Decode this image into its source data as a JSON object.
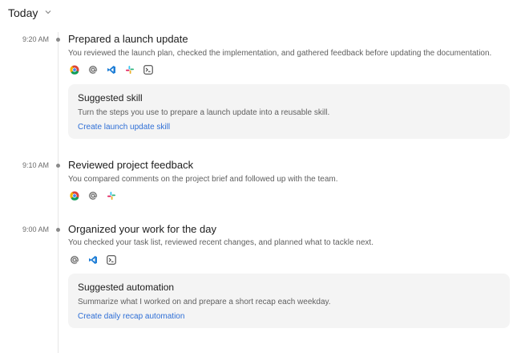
{
  "header": {
    "title": "Today"
  },
  "entries": [
    {
      "time": "9:20 AM",
      "title": "Prepared a launch update",
      "description": "You reviewed the launch plan, checked the implementation, and gathered feedback before updating the documentation.",
      "apps": [
        "chrome-icon",
        "mention-icon",
        "vscode-icon",
        "slack-icon",
        "terminal-icon"
      ],
      "suggestion": {
        "title": "Suggested skill",
        "description": "Turn the steps you use to prepare a launch update into a reusable skill.",
        "link": "Create launch update skill"
      }
    },
    {
      "time": "9:10 AM",
      "title": "Reviewed project feedback",
      "description": "You compared comments on the project brief and followed up with the team.",
      "apps": [
        "chrome-icon",
        "mention-icon",
        "slack-icon"
      ]
    },
    {
      "time": "9:00 AM",
      "title": "Organized your work for the day",
      "description": "You checked your task list, reviewed recent changes, and planned what to tackle next.",
      "apps": [
        "mention-icon",
        "vscode-icon",
        "terminal-icon"
      ],
      "suggestion": {
        "title": "Suggested automation",
        "description": "Summarize what I worked on and prepare a short recap each weekday.",
        "link": "Create daily recap automation"
      }
    }
  ],
  "colors": {
    "link": "#2f6fd6",
    "highlight": "#fff200",
    "card_bg": "#f4f4f4"
  }
}
